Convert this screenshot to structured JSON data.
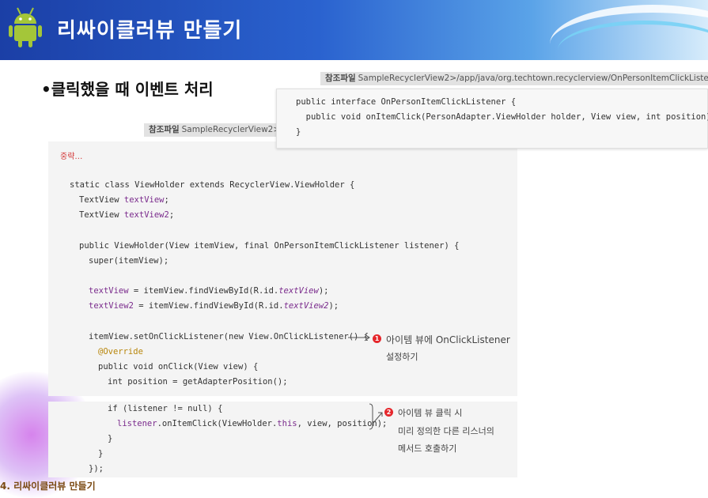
{
  "header": {
    "title": "리싸이클러뷰 만들기",
    "logo_icon": "android-robot-icon"
  },
  "bullet": "•클릭했을 때 이벤트 처리",
  "ref_top": {
    "tag": "참조파일",
    "path": "SampleRecyclerView2>/app/java/org.techtown.recyclerview/OnPersonItemClickListe"
  },
  "interface_code": [
    "public interface OnPersonItemClickListener {",
    "  public void onItemClick(PersonAdapter.ViewHolder holder, View view, int position);",
    "}"
  ],
  "ref_main": {
    "tag": "참조파일",
    "path": "SampleRecyclerView2>"
  },
  "main_code": {
    "omit": "중략…",
    "l1": "static class ViewHolder extends RecyclerView.ViewHolder {",
    "l2a": "TextView ",
    "l2b": "textView",
    "l2c": ";",
    "l3a": "TextView ",
    "l3b": "textView2",
    "l3c": ";",
    "l4": "public ViewHolder(View itemView, final OnPersonItemClickListener listener) {",
    "l5": "super(itemView);",
    "l6a": "textView",
    "l6b": " = itemView.findViewById(R.id.",
    "l6c": "textView",
    "l6d": ");",
    "l7a": "textView2",
    "l7b": " = itemView.findViewById(R.id.",
    "l7c": "textView2",
    "l7d": ");",
    "l8": "itemView.setOnClickListener(new View.OnClickListener() {",
    "l9": "@Override",
    "l10": "public void onClick(View view) {",
    "l11": "int position = getAdapterPosition();",
    "l12": "if (listener != null) {",
    "l13a": "listener",
    "l13b": ".onItemClick(ViewHolder.",
    "l13c": "this",
    "l13d": ", view, position);",
    "l14": "}",
    "l15": "}",
    "l16": "});"
  },
  "notes": {
    "n1_num": "1",
    "n1_line1": "아이템 뷰에 OnClickListener",
    "n1_line2": "설정하기",
    "n2_num": "2",
    "n2_line1": "아이템 뷰 클릭 시",
    "n2_line2": "미리 정의한 다른 리스너의",
    "n2_line3": "메서드 호출하기"
  },
  "footer": "4. 리싸이클러뷰 만들기"
}
